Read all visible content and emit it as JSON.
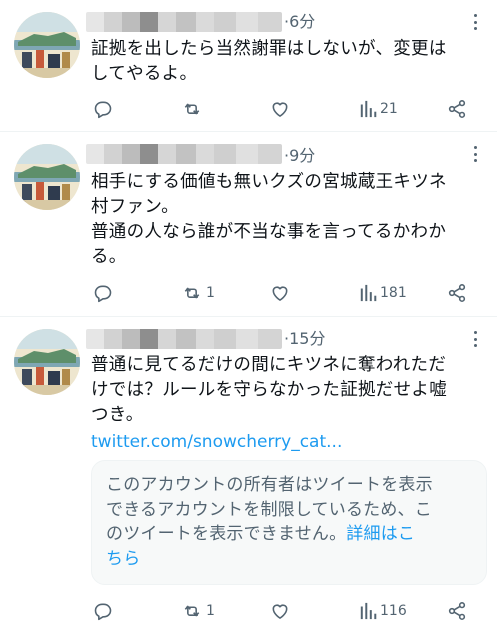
{
  "tweets": [
    {
      "time": "6分",
      "text": "証拠を出したら当然謝罪はしないが、変更は\nしてやるよ。",
      "replies": "",
      "retweets": "",
      "views": "21"
    },
    {
      "time": "9分",
      "text": "相手にする価値も無いクズの宮城蔵王キツネ\n村ファン。\n普通の人なら誰が不当な事を言ってるかわか\nる。",
      "replies": "",
      "retweets": "1",
      "views": "181"
    },
    {
      "time": "15分",
      "text": "普通に見てるだけの間にキツネに奪われただ\nけでは？ルールを守らなかった証拠だせよ嘘\nつき。",
      "link": "twitter.com/snowcherry_cat...",
      "notice": "このアカウントの所有者はツイートを表示\nできるアカウントを制限しているため、こ\nのツイートを表示できません。",
      "notice_link": "詳細はこ\nちら",
      "replies": "",
      "retweets": "1",
      "views": "116"
    }
  ],
  "icons": {
    "reply": "reply-icon",
    "retweet": "retweet-icon",
    "like": "like-icon",
    "views": "views-icon",
    "share": "share-icon",
    "more": "more-icon"
  },
  "colors": {
    "text": "#0f1419",
    "secondary": "#536471",
    "link": "#1d9bf0",
    "divider": "#eff3f4"
  }
}
